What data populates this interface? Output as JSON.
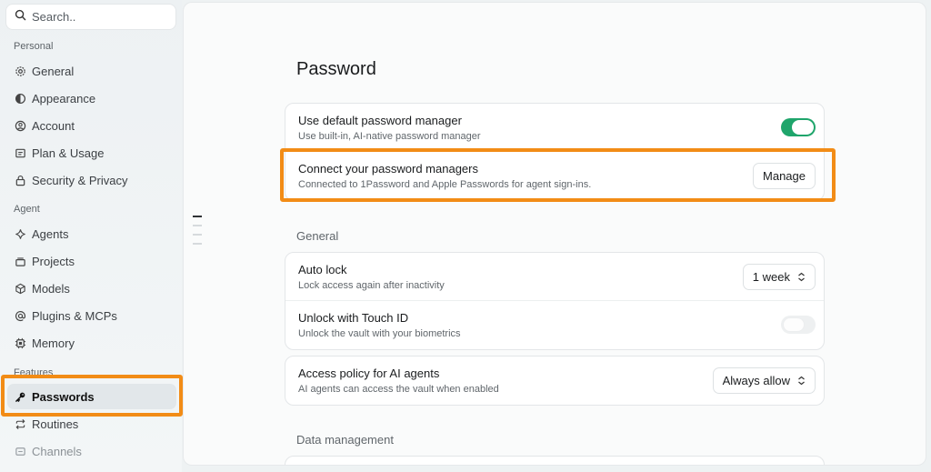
{
  "sidebar": {
    "search_placeholder": "Search..",
    "sections": {
      "personal": "Personal",
      "agent": "Agent",
      "features": "Features"
    },
    "items": [
      {
        "label": "General",
        "icon": "gear-icon"
      },
      {
        "label": "Appearance",
        "icon": "half-circle-icon"
      },
      {
        "label": "Account",
        "icon": "user-circle-icon"
      },
      {
        "label": "Plan & Usage",
        "icon": "receipt-icon"
      },
      {
        "label": "Security & Privacy",
        "icon": "lock-icon"
      },
      {
        "label": "Agents",
        "icon": "sparkle-icon"
      },
      {
        "label": "Projects",
        "icon": "stack-icon"
      },
      {
        "label": "Models",
        "icon": "cube-icon"
      },
      {
        "label": "Plugins & MCPs",
        "icon": "at-icon"
      },
      {
        "label": "Memory",
        "icon": "chip-icon"
      },
      {
        "label": "Passwords",
        "icon": "key-icon",
        "active": true
      },
      {
        "label": "Routines",
        "icon": "repeat-icon"
      },
      {
        "label": "Channels",
        "icon": "channel-icon"
      }
    ]
  },
  "main": {
    "title": "Password",
    "password_card": {
      "default_manager": {
        "title": "Use default password manager",
        "subtitle": "Use built-in, AI-native password manager",
        "enabled": true
      },
      "connect_managers": {
        "title": "Connect your password managers",
        "subtitle": "Connected to 1Password and Apple Passwords for agent sign-ins.",
        "button": "Manage"
      }
    },
    "general_heading": "General",
    "general_card": {
      "auto_lock": {
        "title": "Auto lock",
        "subtitle": "Lock access again after inactivity",
        "value": "1 week"
      },
      "touch_id": {
        "title": "Unlock with Touch ID",
        "subtitle": "Unlock the vault with your biometrics",
        "enabled": false
      }
    },
    "access_card": {
      "title": "Access policy for AI agents",
      "subtitle": "AI agents can access the vault when enabled",
      "value": "Always allow"
    },
    "data_heading": "Data management"
  },
  "colors": {
    "accent_toggle": "#1fa56b",
    "highlight": "#f28c16"
  }
}
